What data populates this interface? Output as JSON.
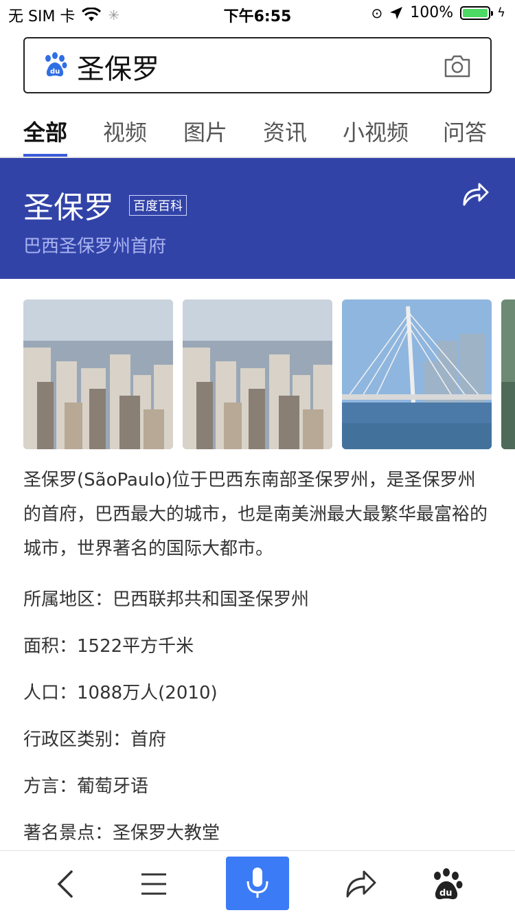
{
  "status_bar": {
    "carrier": "无 SIM 卡",
    "time": "下午6:55",
    "battery": "100%"
  },
  "search": {
    "query": "圣保罗"
  },
  "tabs": [
    {
      "label": "全部",
      "active": true
    },
    {
      "label": "视频"
    },
    {
      "label": "图片"
    },
    {
      "label": "资讯"
    },
    {
      "label": "小视频"
    },
    {
      "label": "问答"
    }
  ],
  "card": {
    "title": "圣保罗",
    "badge": "百度百科",
    "subtitle": "巴西圣保罗州首府"
  },
  "description": "圣保罗(SãoPaulo)位于巴西东南部圣保罗州，是圣保罗州的首府，巴西最大的城市，也是南美洲最大最繁华最富裕的城市，世界著名的国际大都市。",
  "facts": [
    "所属地区：巴西联邦共和国圣保罗州",
    "面积：1522平方千米",
    "人口：1088万人(2010)",
    "行政区类别：首府",
    "方言：葡萄牙语",
    "著名景点：圣保罗大教堂"
  ],
  "colors": {
    "hero_bg": "#3243a8",
    "accent": "#3b5bdb",
    "mic_bg": "#3b7bf6"
  },
  "icons": [
    "wifi-icon",
    "activity-icon",
    "orientation-lock-icon",
    "location-arrow-icon",
    "battery-icon",
    "charging-icon",
    "baidu-paw-icon",
    "camera-icon",
    "share-icon",
    "back-icon",
    "menu-icon",
    "microphone-icon",
    "forward-icon",
    "baidu-logo-icon"
  ]
}
